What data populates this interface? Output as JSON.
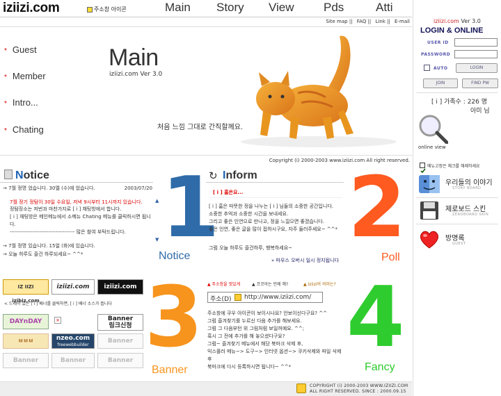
{
  "header": {
    "logo": "iziizi.com",
    "home_label": "주소창 아이콘",
    "nav": [
      "Main",
      "Story",
      "View",
      "Pds",
      "Atti"
    ],
    "sublinks": [
      "Site map ||",
      "FAQ ||",
      "Link ||",
      "E-mail"
    ]
  },
  "main": {
    "menu": [
      "Guest",
      "Member",
      "Intro...",
      "Chating"
    ],
    "title": "Main",
    "version": "iziizi.com Ver 3.0",
    "slogan": "처음 느낌 그대로 간직할께요.",
    "copyright": "Copyright (i) 2000-2003 www.iziizi.com All right reserved."
  },
  "login": {
    "version_site": "iziizi.com",
    "version_num": "Ver 3.0",
    "title": "LOGIN & ONLINE",
    "user_id_label": "USER ID",
    "password_label": "PASSWORD",
    "auto_label": "AUTO",
    "login_btn": "LOGIN",
    "join_btn": "JOIN",
    "find_pw_btn": "FIND PW",
    "members_line": "[ i ] 가족수 : 226 명",
    "user_line": "아미 님",
    "online_view": "online view"
  },
  "rightmenu": {
    "check_label": "메뉴고정은 체크를 해제하세요",
    "items": [
      {
        "title": "우리들의 이야기",
        "sub": "STORY BOARD"
      },
      {
        "title": "제로보드 스킨",
        "sub": "ZEROBOARD SKIN"
      },
      {
        "title": "방명록",
        "sub": "GUEST"
      }
    ]
  },
  "notice": {
    "head_first": "N",
    "head_rest": "otice",
    "big_number": "1",
    "caption": "Notice",
    "item1": "7월 정명 었습니다. 30엘 (수)에 었습니다.",
    "item1_date": "2003/07/20",
    "red_line": "7월 정기 정탐이 30일 수요일, 저녁 9시부터 11시까지 있습니다.",
    "body": [
      "정탐장소는 저번과 마찬가지로 [ i ] 채팅방에서 합니다.",
      "[ i ] 채팅방은 메인메뉴에서 소메뉴 Chating 메뉴를 클릭하시면 됩니다.",
      "------------------------------------- 많은 참여 부탁드립니다."
    ],
    "item2": "7월 정명 있습니다. 15얼 (화)에 있습니다.",
    "item3": "오늘 하루도 즐건 하루되세요~ ^^*"
  },
  "inform": {
    "head_first": "I",
    "head_rest": "nform",
    "big_number": "2",
    "caption": "Poll",
    "title": "[ i ] 홈은요...",
    "body": [
      "[ i ] 홈은 따뜻한 정을 나누는 [ i ] 님들의 소중한 공간입니다.",
      "소중한 추억과 소중한 시간을 보내세요.",
      "그리고 좋은 인연으로 만나고, 정을 느낄으면 좋겠습니다.",
      "좋은 인연, 좋은 글을 많이 접하시구요, 자주 들러주세요~ ^^*"
    ],
    "closing": "그럼 오늘 하루도 즐건하루, 행복하세요~",
    "link": "마우스 오버시 일시 정지됩니다"
  },
  "banner": {
    "big_number": "3",
    "caption": "Banner",
    "row1": [
      "IZ IIZI izibiz.com",
      "iziizi.com",
      "iziizi.com"
    ],
    "note": "< 드레이 있는 [ i ] 배너를 클릭하면, [ i ] 배너 소스가 뜹니다",
    "dayndday": "DAYnDAY",
    "banner_btn_line1": "Banner",
    "banner_btn_line2": "링크신청",
    "bye": "ㅂㅂㅂ",
    "nzeo": "nzeo.com",
    "nzeo_sub": "freewebbuilder",
    "placeholder": "Banner"
  },
  "fancy": {
    "big_number": "4",
    "caption": "Fancy",
    "tabs": [
      "주소창을 멋있게",
      "코코아는 언제 해?",
      "iziizi의 의미는?"
    ],
    "address_label": "주소(D)",
    "address_value": "http://www.iziizi.com/",
    "body": [
      "주소창에 쿠우 아이콘이 보이시나요? 안보이신다구요? ^^",
      "그럼 즐겨찾기를 누르신 다음 추가를 해보세요.",
      "그럼 그 다음부턴 위 그림처럼 보일꺼예요. ^^;",
      "혹시 그 전에 추가를 해 놓으셨다구요?",
      "그럼~ 즐겨찾기 메뉴에서 해당 북마크 삭제 후,",
      "익스플러 메뉴~> 도구~> 인터넷 옵션~> 쿠키삭제와 파일 삭제 후",
      "북마크에 다시 등록하시면 됩니다~ ^^*"
    ]
  },
  "footer": {
    "line1": "COPYRIGHT (i) 2000-2003 WWW.IZIIZI.COM",
    "line2": "ALL RIGHT RESERVED. SINCE : 2000.09.15"
  }
}
